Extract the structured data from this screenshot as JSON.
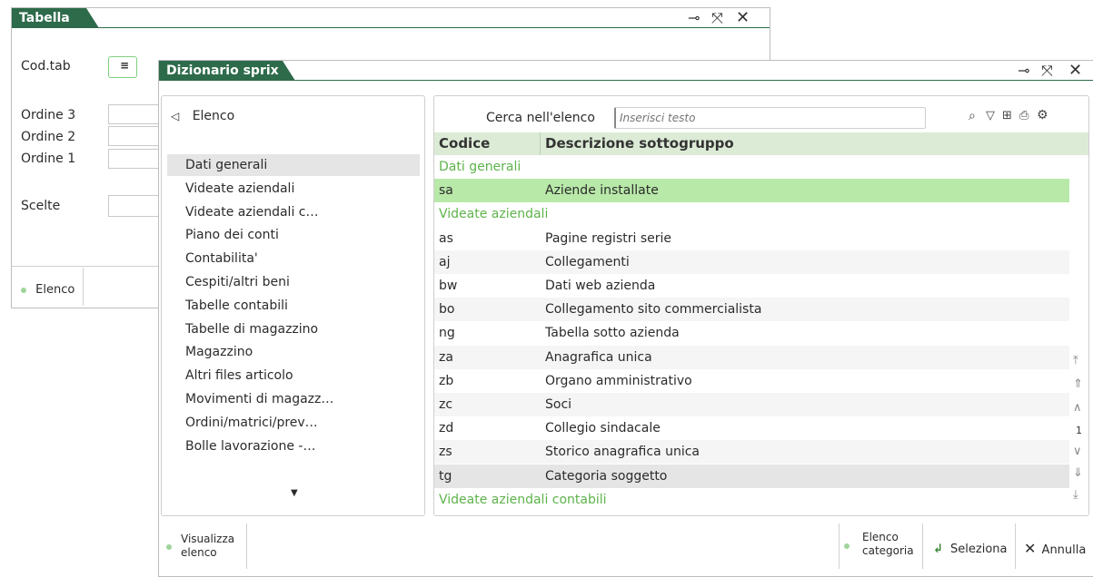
{
  "back_window": {
    "title": "Tabella",
    "fields": {
      "cod_tab": "Cod.tab",
      "ordine3": "Ordine 3",
      "ordine2": "Ordine 2",
      "ordine1": "Ordine 1",
      "scelte": "Scelte"
    },
    "footer_button": "Elenco"
  },
  "dialog": {
    "title": "Dizionario sprix",
    "nav": {
      "header": "Elenco",
      "items": [
        "Dati generali",
        "Videate aziendali",
        "Videate aziendali c…",
        "Piano dei conti",
        "Contabilita'",
        "Cespiti/altri beni",
        "Tabelle contabili",
        "Tabelle di magazzino",
        "Magazzino",
        "Altri files articolo",
        "Movimenti di magazz…",
        "Ordini/matrici/prev…",
        "Bolle lavorazione -…"
      ]
    },
    "search": {
      "label": "Cerca nell'elenco",
      "placeholder": "Inserisci testo"
    },
    "table": {
      "headers": [
        "Codice",
        "Descrizione sottogruppo"
      ],
      "rows": [
        {
          "type": "group",
          "code": "Dati generali",
          "desc": ""
        },
        {
          "type": "row",
          "code": "sa",
          "desc": "Aziende installate"
        },
        {
          "type": "group",
          "code": "Videate aziendali",
          "desc": ""
        },
        {
          "type": "row",
          "code": "as",
          "desc": "Pagine registri serie"
        },
        {
          "type": "row",
          "code": "aj",
          "desc": "Collegamenti"
        },
        {
          "type": "row",
          "code": "bw",
          "desc": "Dati web azienda"
        },
        {
          "type": "row",
          "code": "bo",
          "desc": "Collegamento sito commercialista"
        },
        {
          "type": "row",
          "code": "ng",
          "desc": "Tabella sotto azienda"
        },
        {
          "type": "row",
          "code": "za",
          "desc": "Anagrafica unica"
        },
        {
          "type": "row",
          "code": "zb",
          "desc": "Organo amministrativo"
        },
        {
          "type": "row",
          "code": "zc",
          "desc": "Soci"
        },
        {
          "type": "row",
          "code": "zd",
          "desc": "Collegio sindacale"
        },
        {
          "type": "row",
          "code": "zs",
          "desc": "Storico anagrafica unica"
        },
        {
          "type": "row",
          "code": "tg",
          "desc": "Categoria soggetto"
        },
        {
          "type": "group",
          "code": "Videate aziendali contabili",
          "desc": ""
        }
      ]
    },
    "page_number": "1",
    "footer": {
      "visualizza_line1": "Visualizza",
      "visualizza_line2": "elenco",
      "elenco_cat_line1": "Elenco",
      "elenco_cat_line2": "categoria",
      "seleziona": "Seleziona",
      "annulla": "Annulla"
    }
  },
  "colors": {
    "title_bar": "#2d6b4a",
    "group_text": "#5db34a",
    "selected_row": "#b8e9a9",
    "header_row": "#dcebd6"
  }
}
